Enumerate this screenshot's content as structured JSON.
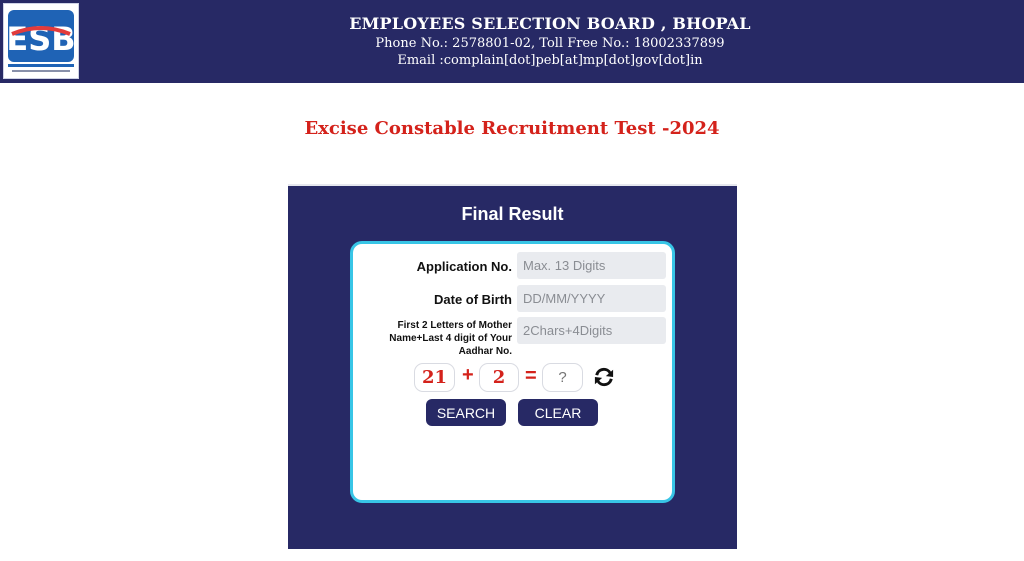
{
  "header": {
    "logo_text": "ESB",
    "org_name": "EMPLOYEES SELECTION BOARD , BHOPAL",
    "phone_line": "Phone No.: 2578801-02, Toll Free No.: 18002337899",
    "email_line": "Email :complain[dot]peb[at]mp[dot]gov[dot]in"
  },
  "exam_title": "Excise Constable Recruitment Test -2024",
  "panel": {
    "title": "Final Result",
    "fields": [
      {
        "label": "Application No.",
        "placeholder": "Max. 13 Digits"
      },
      {
        "label": "Date of Birth",
        "placeholder": "DD/MM/YYYY"
      },
      {
        "label": "First 2 Letters of Mother Name+Last 4 digit of Your Aadhar No.",
        "placeholder": "2Chars+4Digits"
      }
    ],
    "captcha": {
      "num1": "21",
      "operator": "+",
      "num2": "2",
      "equals": "=",
      "answer_placeholder": "?"
    },
    "buttons": {
      "search": "SEARCH",
      "clear": "CLEAR"
    }
  },
  "colors": {
    "navy": "#272965",
    "title_red": "#d4221b",
    "card_border": "#38c5e6",
    "input_bg": "#e9ebef"
  },
  "icons": {
    "refresh": "refresh-icon"
  }
}
